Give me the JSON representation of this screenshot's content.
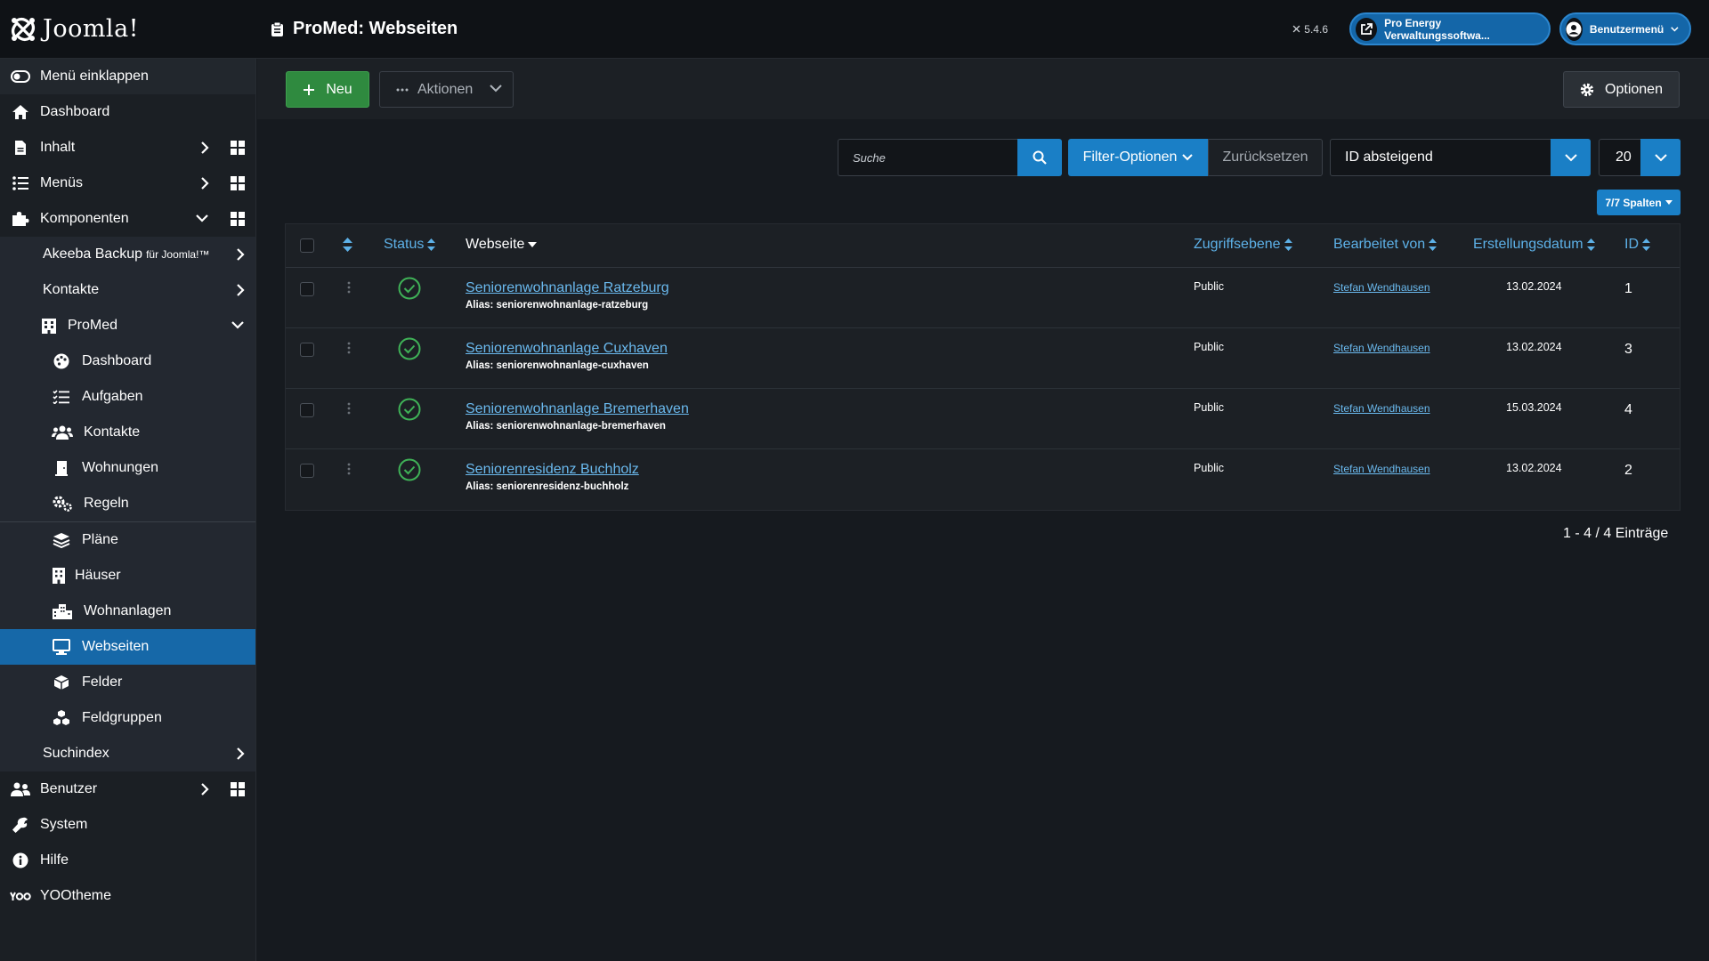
{
  "header": {
    "brand": "Joomla!",
    "title": "ProMed: Webseiten",
    "version": "5.4.6",
    "site_button": "Pro Energy Verwaltungssoftwa...",
    "user_menu": "Benutzermenü"
  },
  "sidebar": {
    "collapse": "Menü einklappen",
    "dashboard": "Dashboard",
    "content": "Inhalt",
    "menus": "Menüs",
    "components": "Komponenten",
    "akeeba": "Akeeba Backup",
    "akeeba_small": "für Joomla!™",
    "contacts": "Kontakte",
    "promed": "ProMed",
    "promed_items": [
      {
        "label": "Dashboard",
        "icon": "palette-icon"
      },
      {
        "label": "Aufgaben",
        "icon": "tasks-icon"
      },
      {
        "label": "Kontakte",
        "icon": "users-icon"
      },
      {
        "label": "Wohnungen",
        "icon": "door-icon"
      },
      {
        "label": "Regeln",
        "icon": "cogs-icon"
      },
      {
        "label": "Pläne",
        "icon": "layers-icon"
      },
      {
        "label": "Häuser",
        "icon": "building-icon"
      },
      {
        "label": "Wohnanlagen",
        "icon": "city-icon"
      },
      {
        "label": "Webseiten",
        "icon": "desktop-icon"
      },
      {
        "label": "Felder",
        "icon": "cube-icon"
      },
      {
        "label": "Feldgruppen",
        "icon": "cubes-icon"
      }
    ],
    "smart_search": "Suchindex",
    "users": "Benutzer",
    "system": "System",
    "help": "Hilfe",
    "yootheme": "YOOtheme"
  },
  "toolbar": {
    "new_label": "Neu",
    "actions_label": "Aktionen",
    "options_label": "Optionen"
  },
  "filters": {
    "search_placeholder": "Suche",
    "filter_options": "Filter-Optionen",
    "reset": "Zurücksetzen",
    "sort": "ID absteigend",
    "limit": "20",
    "columns": "7/7 Spalten"
  },
  "table": {
    "headers": {
      "status": "Status",
      "website": "Webseite",
      "access": "Zugriffsebene",
      "author": "Bearbeitet von",
      "created": "Erstellungsdatum",
      "id": "ID"
    },
    "rows": [
      {
        "title": "Seniorenwohnanlage Ratzeburg",
        "alias": "Alias: seniorenwohnanlage-ratzeburg",
        "access": "Public",
        "author": "Stefan Wendhausen",
        "date": "13.02.2024",
        "id": "1"
      },
      {
        "title": "Seniorenwohnanlage Cuxhaven",
        "alias": "Alias: seniorenwohnanlage-cuxhaven",
        "access": "Public",
        "author": "Stefan Wendhausen",
        "date": "13.02.2024",
        "id": "3"
      },
      {
        "title": "Seniorenwohnanlage Bremerhaven",
        "alias": "Alias: seniorenwohnanlage-bremerhaven",
        "access": "Public",
        "author": "Stefan Wendhausen",
        "date": "15.03.2024",
        "id": "4"
      },
      {
        "title": "Seniorenresidenz Buchholz",
        "alias": "Alias: seniorenresidenz-buchholz",
        "access": "Public",
        "author": "Stefan Wendhausen",
        "date": "13.02.2024",
        "id": "2"
      }
    ]
  },
  "pagination": "1 - 4 / 4 Einträge",
  "colors": {
    "accent": "#1a7fc6",
    "success": "#2f8a3f",
    "background": "#161a1f"
  }
}
